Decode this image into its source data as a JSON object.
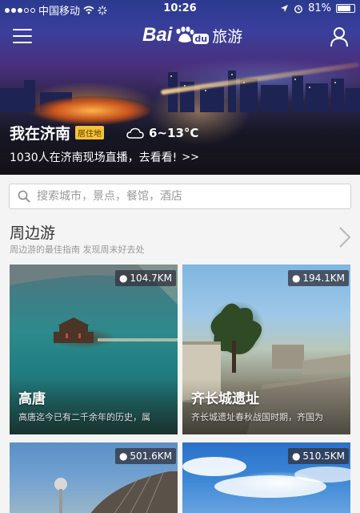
{
  "status_bar": {
    "carrier": "中国移动",
    "time": "10:26",
    "battery": "81%",
    "battery_level": 0.81
  },
  "header": {
    "logo_text": "Bai",
    "logo_badge": "du",
    "logo_suffix": "旅游",
    "menu_icon": "menu-icon",
    "user_icon": "user-icon"
  },
  "city": {
    "name": "我在济南",
    "tag": "居住地",
    "weather_icon": "cloud-icon",
    "temperature": "6~13°C",
    "live_text": "1030人在济南现场直播，去看看!",
    "live_arrow": ">>"
  },
  "search": {
    "placeholder": "搜索城市，景点，餐馆，酒店",
    "value": ""
  },
  "section": {
    "title": "周边游",
    "subtitle": "周边游的最佳指南 发现周末好去处"
  },
  "cards": [
    {
      "distance": "104.7KM",
      "title": "高唐",
      "desc": "高唐迄今已有二千余年的历史，属"
    },
    {
      "distance": "194.1KM",
      "title": "齐长城遗址",
      "desc": "齐长城遗址春秋战国时期，齐国为"
    },
    {
      "distance": "501.6KM",
      "title": "",
      "desc": ""
    },
    {
      "distance": "510.5KM",
      "title": "",
      "desc": ""
    }
  ],
  "colors": {
    "accent_tag": "#f5c23a",
    "page_bg": "#f4f4f4"
  }
}
